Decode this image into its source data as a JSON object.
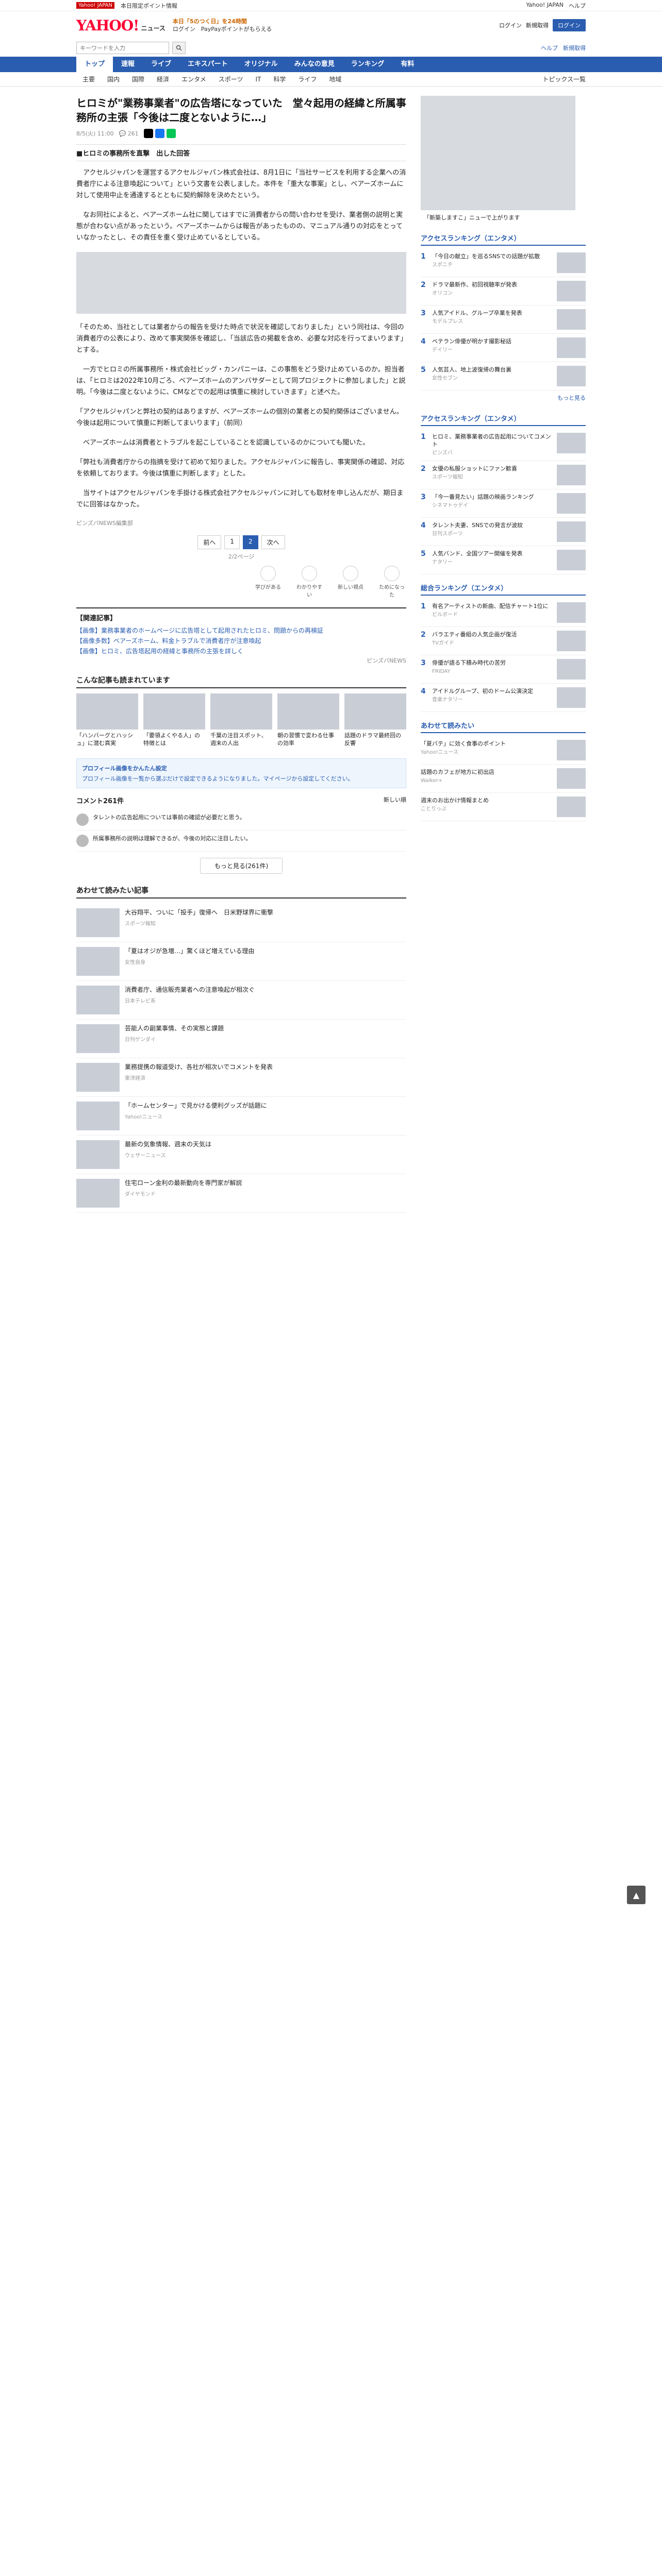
{
  "topline": {
    "badge": "Yahoo! JAPAN",
    "promo": "本日限定ポイント情報",
    "right": [
      "Yahoo! JAPAN",
      "ヘルプ"
    ]
  },
  "header": {
    "logo": "YAHOO!",
    "logo_sub": "ニュース",
    "promo_lines": [
      "本日「5のつく日」を24時間",
      "ログイン　PayPayポイントがもらえる"
    ],
    "right_links": [
      "ログイン",
      "新規取得"
    ],
    "login_button": "ログイン"
  },
  "search": {
    "placeholder": "キーワードを入力",
    "right_links": [
      "ヘルプ",
      "新規取得"
    ]
  },
  "nav": {
    "items": [
      "トップ",
      "速報",
      "ライブ",
      "エキスパート",
      "オリジナル",
      "みんなの意見",
      "ランキング",
      "有料"
    ],
    "active": 0
  },
  "subnav": {
    "items": [
      "主要",
      "国内",
      "国際",
      "経済",
      "エンタメ",
      "スポーツ",
      "IT",
      "科学",
      "ライフ",
      "地域"
    ],
    "right": "トピックス一覧"
  },
  "article": {
    "title": "ヒロミが\"業務事業者\"の広告塔になっていた　堂々起用の経緯と所属事務所の主張「今後は二度とないように…」",
    "date": "8/5(火) 11:00",
    "comments_count": "261",
    "sub_head": "■ヒロミの事務所を直撃　出した回答",
    "paragraphs": [
      "　アクセルジャパンを運営するアクセルジャパン株式会社は、8月1日に「当社サービスを利用する企業への消費者庁による注意喚起について」という文書を公表しました。本件を「重大な事案」とし、ベアーズホームに対して使用中止を通達するとともに契約解除を決めたという。",
      "　なお同社によると、ベアーズホーム社に関してはすでに消費者からの問い合わせを受け、業者側の説明と実態が合わない点があったという。ベアーズホームからは報告があったものの、マニュアル通りの対応をとっていなかったとし、その責任を重く受け止めているとしている。",
      "「そのため、当社としては業者からの報告を受けた時点で状況を確認しておりました」という同社は、今回の消費者庁の公表により、改めて事実関係を確認し、「当該広告の掲載を含め、必要な対応を行ってまいります」とする。",
      "　一方でヒロミの所属事務所・株式会社ビッグ・カンパニーは、この事態をどう受け止めているのか。担当者は、「ヒロミは2022年10月ごろ、ベアーズホームのアンバサダーとして同プロジェクトに参加しました」と説明。「今後は二度とないように、CMなどでの起用は慎重に検討していきます」と述べた。",
      "「アクセルジャパンと弊社の契約はありますが、ベアーズホームの個別の業者との契約関係はございません。今後は起用について慎重に判断してまいります」（前同）",
      "　ベアーズホームは消費者とトラブルを起こしていることを認識しているのかについても聞いた。",
      "「弊社も消費者庁からの指摘を受けて初めて知りました。アクセルジャパンに報告し、事実関係の確認、対応を依頼しております。今後は慎重に判断します」とした。",
      "　当サイトはアクセルジャパンを手掛ける株式会社アクセルジャパンに対しても取材を申し込んだが、期日までに回答はなかった。"
    ],
    "source": "ピンズバNEWS編集部",
    "publisher": "ピンズバ",
    "pager": [
      "前へ",
      "1",
      "2",
      "次へ"
    ],
    "pager_current": 1,
    "pager_note": "2/2ページ",
    "reactions": [
      "学びがある",
      "わかりやすい",
      "新しい視点",
      "ためになった"
    ],
    "related_title": "【関連記事】",
    "related": [
      "【画像】業務事業者のホームページに広告塔として起用されたヒロミ、問題からの再検証",
      "【画像多数】ベアーズホーム、料金トラブルで消費者庁が注意喚起",
      "【画像】ヒロミ、広告塔起用の経緯と事務所の主張を詳しく"
    ],
    "credit": "ピンズバNEWS"
  },
  "recommend": {
    "title": "こんな記事も読まれています",
    "items": [
      "「ハンバーグとハッシュ」に潜む真実",
      "「要領よくやる人」の特徴とは",
      "千葉の注目スポット、週末の人出",
      "朝の習慣で変わる仕事の効率",
      "話題のドラマ最終回の反響"
    ]
  },
  "comments": {
    "notice_title": "プロフィール画像をかんたん設定",
    "notice_body": "プロフィール画像を一覧から選ぶだけで設定できるようになりました。マイページから設定してください。",
    "count_label": "コメント261件",
    "sort": "新しい順",
    "items": [
      "タレントの広告起用については事前の確認が必要だと思う。",
      "所属事務所の説明は理解できるが、今後の対応に注目したい。"
    ],
    "more": "もっと見る(261件)"
  },
  "more_articles": {
    "title": "あわせて読みたい記事",
    "items": [
      {
        "text": "大谷翔平、ついに「投手」復帰へ　日米野球界に衝撃",
        "src": "スポーツ報知"
      },
      {
        "text": "「夏はオジが急増…」驚くほど増えている理由",
        "src": "女性自身"
      },
      {
        "text": "消費者庁、通信販売業者への注意喚起が相次ぐ",
        "src": "日本テレビ系"
      },
      {
        "text": "芸能人の副業事情、その実態と課題",
        "src": "日刊ゲンダイ"
      },
      {
        "text": "業務提携の報道受け、各社が相次いでコメントを発表",
        "src": "東洋経済"
      },
      {
        "text": "「ホームセンター」で見かける便利グッズが話題に",
        "src": "Yahoo!ニュース"
      },
      {
        "text": "最新の気象情報、週末の天気は",
        "src": "ウェザーニュース"
      },
      {
        "text": "住宅ローン金利の最新動向を専門家が解説",
        "src": "ダイヤモンド"
      }
    ]
  },
  "side": {
    "ad_caption": "「新築しますこ」ニューで上がります",
    "ranking_title": "アクセスランキング（エンタメ）",
    "ranking": [
      {
        "text": "「今日の献立」を巡るSNSでの話題が拡散",
        "src": "スポニチ"
      },
      {
        "text": "ドラマ最新作、初回視聴率が発表",
        "src": "オリコン"
      },
      {
        "text": "人気アイドル、グループ卒業を発表",
        "src": "モデルプレス"
      },
      {
        "text": "ベテラン俳優が明かす撮影秘話",
        "src": "デイリー"
      },
      {
        "text": "人気芸人、地上波復帰の舞台裏",
        "src": "女性セブン"
      }
    ],
    "ranking2_title": "アクセスランキング（エンタメ）",
    "ranking2": [
      {
        "text": "ヒロミ、業務事業者の広告起用についてコメント",
        "src": "ピンズバ"
      },
      {
        "text": "女優の私服ショットにファン歓喜",
        "src": "スポーツ報知"
      },
      {
        "text": "「今一番見たい」話題の映画ランキング",
        "src": "シネマトゥデイ"
      },
      {
        "text": "タレント夫妻、SNSでの発言が波紋",
        "src": "日刊スポーツ"
      },
      {
        "text": "人気バンド、全国ツアー開催を発表",
        "src": "ナタリー"
      }
    ],
    "ranking3_title": "総合ランキング（エンタメ）",
    "ranking3": [
      {
        "text": "有名アーティストの新曲、配信チャート1位に",
        "src": "ビルボード"
      },
      {
        "text": "バラエティ番組の人気企画が復活",
        "src": "TVガイド"
      },
      {
        "text": "俳優が語る下積み時代の苦労",
        "src": "FRIDAY"
      },
      {
        "text": "アイドルグループ、初のドーム公演決定",
        "src": "音楽ナタリー"
      }
    ],
    "pickup_title": "あわせて読みたい",
    "pickup": [
      {
        "text": "「夏バテ」に効く食事のポイント",
        "src": "Yahoo!ニュース"
      },
      {
        "text": "話題のカフェが地方に初出店",
        "src": "Walker+"
      },
      {
        "text": "週末のお出かけ情報まとめ",
        "src": "ことりっぷ"
      }
    ],
    "more": "もっと見る"
  },
  "colors": {
    "brand": "#ff0033",
    "nav": "#2a5db0"
  }
}
